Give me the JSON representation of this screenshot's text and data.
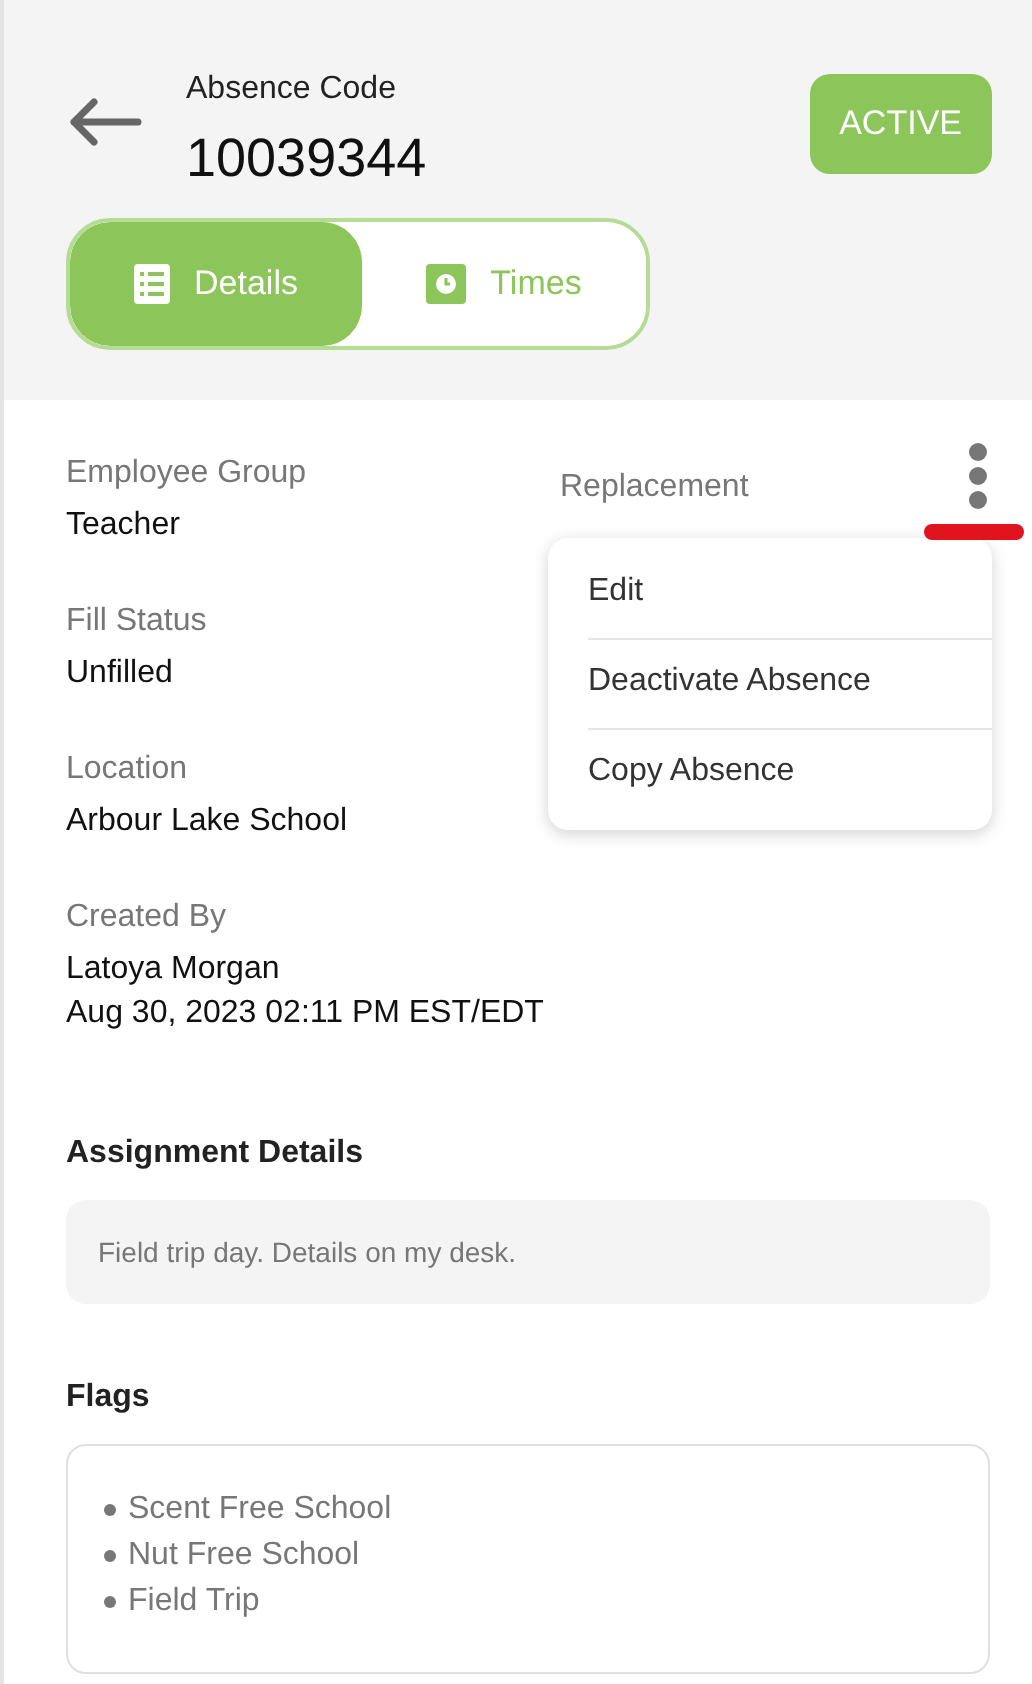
{
  "header": {
    "label": "Absence Code",
    "code": "10039344",
    "status": "ACTIVE"
  },
  "tabs": [
    {
      "label": "Details",
      "selected": true
    },
    {
      "label": "Times",
      "selected": false
    }
  ],
  "fields_left": [
    {
      "label": "Employee Group",
      "lines": [
        "Teacher"
      ]
    },
    {
      "label": "Fill Status",
      "lines": [
        "Unfilled"
      ]
    },
    {
      "label": "Location",
      "lines": [
        "Arbour Lake School"
      ]
    },
    {
      "label": "Created By",
      "lines": [
        "Latoya Morgan",
        "Aug 30, 2023 02:11 PM EST/EDT"
      ]
    }
  ],
  "replacement": {
    "label": "Replacement"
  },
  "menu": {
    "open": true,
    "items": [
      "Edit",
      "Deactivate Absence",
      "Copy Absence"
    ]
  },
  "assignment": {
    "title": "Assignment Details",
    "text": "Field trip day. Details on my desk."
  },
  "flags": {
    "title": "Flags",
    "items": [
      "Scent Free School",
      "Nut Free School",
      "Field Trip"
    ]
  }
}
